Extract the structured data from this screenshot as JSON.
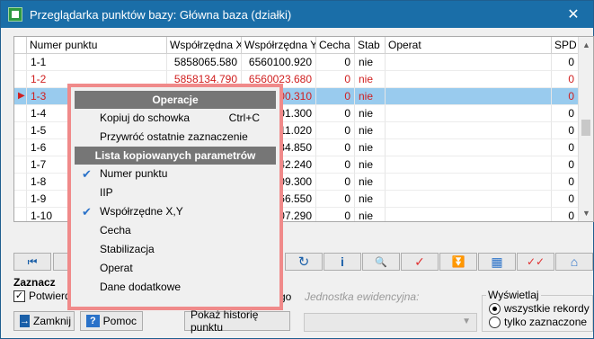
{
  "window": {
    "title": "Przeglądarka punktów bazy: Główna baza (działki)",
    "close_glyph": "✕"
  },
  "grid": {
    "columns": [
      "",
      "Numer punktu",
      "Współrzędna X",
      "Współrzędna Y",
      "Cecha",
      "Stab",
      "Operat",
      "SPD"
    ],
    "rows": [
      {
        "pointer": "",
        "num": "1-1",
        "x": "5858065.580",
        "y": "6560100.920",
        "cecha": "0",
        "stab": "nie",
        "operat": "",
        "spd": "0",
        "style": "normal"
      },
      {
        "pointer": "",
        "num": "1-2",
        "x": "5858134.790",
        "y": "6560023.680",
        "cecha": "0",
        "stab": "nie",
        "operat": "",
        "spd": "0",
        "style": "red"
      },
      {
        "pointer": "▶",
        "num": "1-3",
        "x": "",
        "y": "000.310",
        "cecha": "0",
        "stab": "nie",
        "operat": "",
        "spd": "0",
        "style": "selected"
      },
      {
        "pointer": "",
        "num": "1-4",
        "x": "",
        "y": "01.300",
        "cecha": "0",
        "stab": "nie",
        "operat": "",
        "spd": "0",
        "style": "normal"
      },
      {
        "pointer": "",
        "num": "1-5",
        "x": "",
        "y": "11.020",
        "cecha": "0",
        "stab": "nie",
        "operat": "",
        "spd": "0",
        "style": "normal"
      },
      {
        "pointer": "",
        "num": "1-6",
        "x": "",
        "y": "34.850",
        "cecha": "0",
        "stab": "nie",
        "operat": "",
        "spd": "0",
        "style": "normal"
      },
      {
        "pointer": "",
        "num": "1-7",
        "x": "",
        "y": "42.240",
        "cecha": "0",
        "stab": "nie",
        "operat": "",
        "spd": "0",
        "style": "normal"
      },
      {
        "pointer": "",
        "num": "1-8",
        "x": "",
        "y": "09.300",
        "cecha": "0",
        "stab": "nie",
        "operat": "",
        "spd": "0",
        "style": "normal"
      },
      {
        "pointer": "",
        "num": "1-9",
        "x": "",
        "y": "66.550",
        "cecha": "0",
        "stab": "nie",
        "operat": "",
        "spd": "0",
        "style": "normal"
      },
      {
        "pointer": "",
        "num": "1-10",
        "x": "",
        "y": "07.290",
        "cecha": "0",
        "stab": "nie",
        "operat": "",
        "spd": "0",
        "style": "normal"
      }
    ],
    "scroll": {
      "up": "▲",
      "down": "▼"
    }
  },
  "toolbar": {
    "first_icon": "⏮",
    "refresh_icon": "↻",
    "info_icon": "i",
    "search_icon": "🔍",
    "check_icon": "✓",
    "filter_icon": "⏬",
    "grid_icon": "▦",
    "checks_icon": "✓✓",
    "house_icon": "⌂"
  },
  "bottom": {
    "section_label": "Zaznacz",
    "checkbox_label": "Potwierd",
    "checkbox_mark": "✓",
    "go_text": "go",
    "jednostka_label": "Jednostka ewidencyjna:",
    "jednostka_arrow": "▼",
    "display_group": "Wyświetlaj",
    "radio_all": "wszystkie rekordy",
    "radio_selected": "tylko zaznaczone",
    "close_button": "Zamknij",
    "help_button": "Pomoc",
    "history_button": "Pokaż historię punktu"
  },
  "menu": {
    "header_ops": "Operacje",
    "items_ops": [
      {
        "label": "Kopiuj do schowka",
        "shortcut": "Ctrl+C"
      },
      {
        "label": "Przywróć ostatnie zaznaczenie",
        "shortcut": ""
      }
    ],
    "header_params": "Lista kopiowanych parametrów",
    "items_params": [
      {
        "label": "Numer punktu",
        "checked": true
      },
      {
        "label": "IIP",
        "checked": false
      },
      {
        "label": "Współrzędne X,Y",
        "checked": true
      },
      {
        "label": "Cecha",
        "checked": false
      },
      {
        "label": "Stabilizacja",
        "checked": false
      },
      {
        "label": "Operat",
        "checked": false
      },
      {
        "label": "Dane dodatkowe",
        "checked": false
      }
    ],
    "check_glyph": "✔"
  },
  "colors": {
    "titlebar": "#1a6ea8",
    "selection": "#99cbee",
    "menu_border": "#f08a8a",
    "red_text": "#d02020"
  }
}
